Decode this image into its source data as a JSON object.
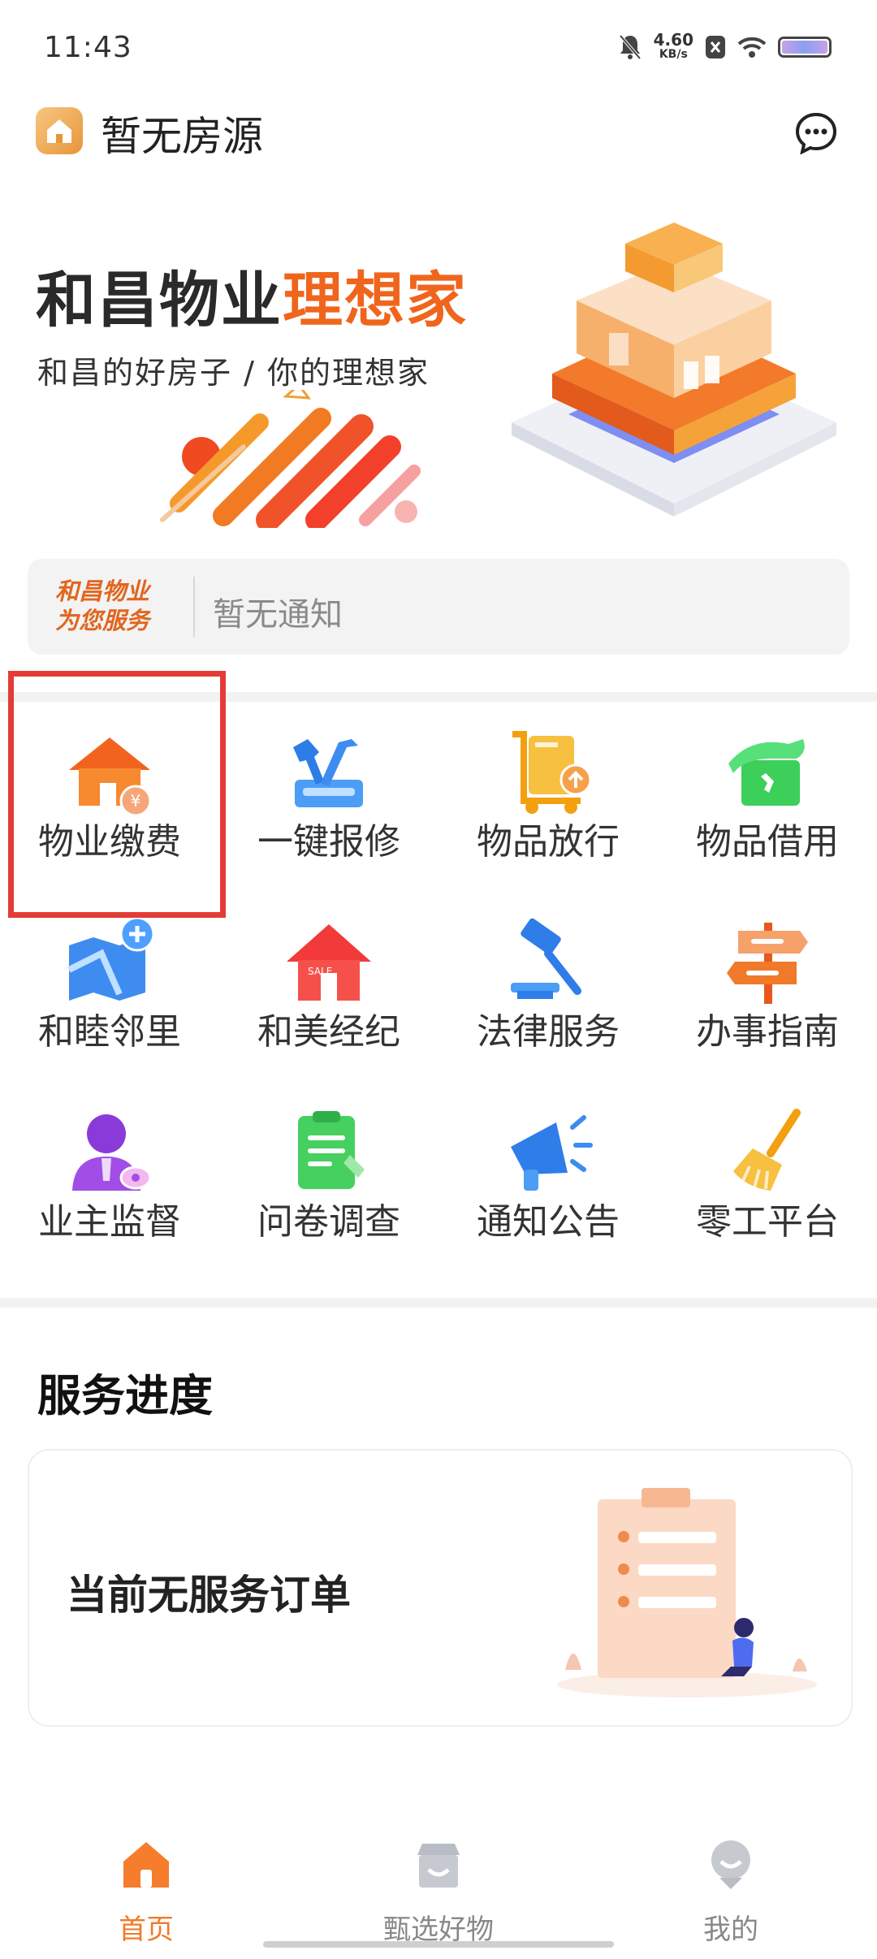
{
  "status_bar": {
    "time": "11:43",
    "speed_value": "4.60",
    "speed_unit": "KB/s"
  },
  "header": {
    "title": "暂无房源"
  },
  "banner": {
    "title_part1": "和昌物业",
    "title_part2": "理想家",
    "subtitle": "和昌的好房子 / 你的理想家"
  },
  "notice": {
    "brand_line1": "和昌物业",
    "brand_line2": "为您服务",
    "text": "暂无通知"
  },
  "services_grid": [
    {
      "label": "物业缴费",
      "icon": "property-fee-icon"
    },
    {
      "label": "一键报修",
      "icon": "repair-icon"
    },
    {
      "label": "物品放行",
      "icon": "item-release-icon"
    },
    {
      "label": "物品借用",
      "icon": "item-borrow-icon"
    },
    {
      "label": "和睦邻里",
      "icon": "neighbors-icon"
    },
    {
      "label": "和美经纪",
      "icon": "real-estate-agency-icon"
    },
    {
      "label": "法律服务",
      "icon": "legal-service-icon"
    },
    {
      "label": "办事指南",
      "icon": "guide-icon"
    },
    {
      "label": "业主监督",
      "icon": "owner-supervision-icon"
    },
    {
      "label": "问卷调查",
      "icon": "survey-icon"
    },
    {
      "label": "通知公告",
      "icon": "announcement-icon"
    },
    {
      "label": "零工平台",
      "icon": "gig-platform-icon"
    }
  ],
  "service_progress": {
    "title": "服务进度",
    "empty_text": "当前无服务订单"
  },
  "tab_bar": [
    {
      "label": "首页",
      "icon": "home-icon",
      "active": true
    },
    {
      "label": "甄选好物",
      "icon": "shop-icon",
      "active": false
    },
    {
      "label": "我的",
      "icon": "profile-icon",
      "active": false
    }
  ],
  "colors": {
    "accent": "#f07a2a",
    "highlight_border": "#e53b35",
    "banner_highlight": "#f0651c"
  }
}
